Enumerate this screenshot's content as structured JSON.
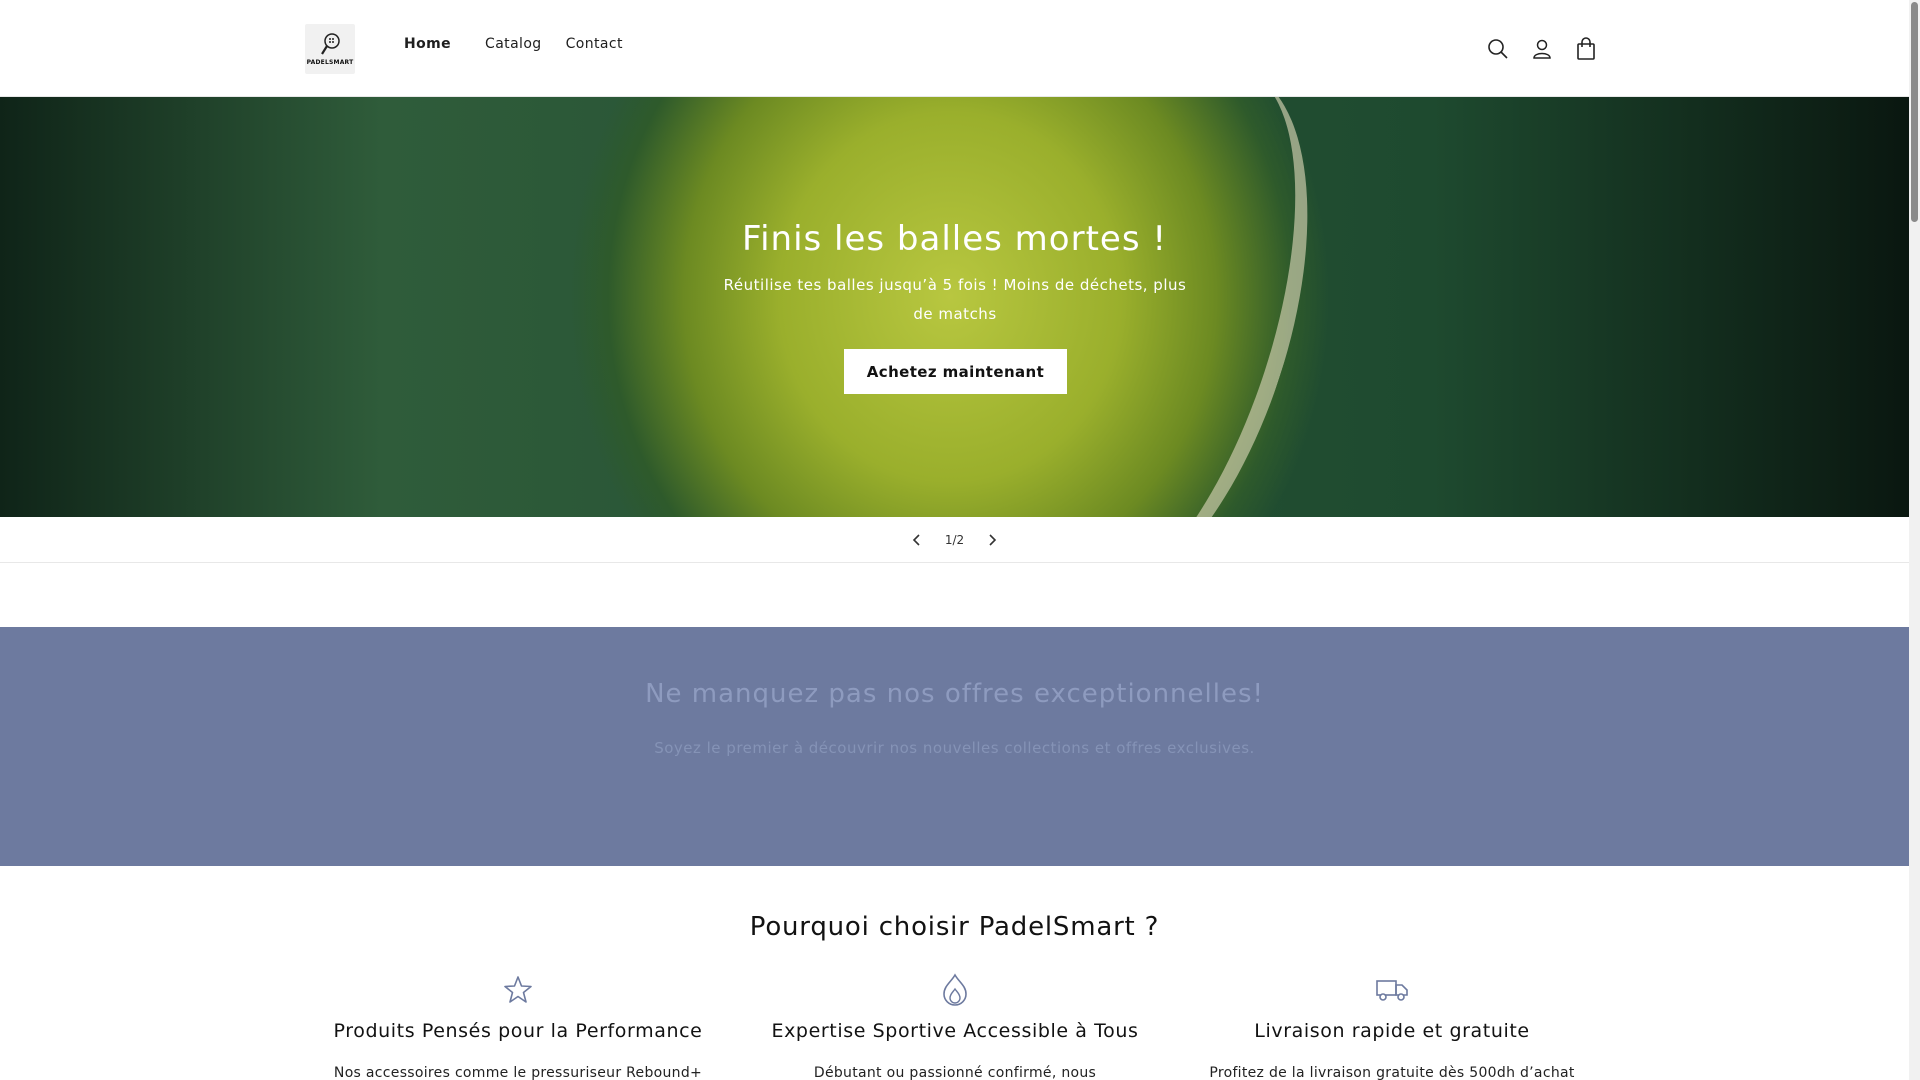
{
  "header": {
    "logo_text": "PADELSMART",
    "nav": [
      {
        "label": "Home",
        "active": true
      },
      {
        "label": "Catalog",
        "active": false
      },
      {
        "label": "Contact",
        "active": false
      }
    ],
    "icons": [
      "search-icon",
      "account-icon",
      "cart-icon"
    ]
  },
  "hero": {
    "title": "Finis les balles mortes !",
    "subtitle": "Réutilise tes balles jusqu’à 5 fois ! Moins de déchets, plus de matchs",
    "button_label": "Achetez maintenant"
  },
  "slider": {
    "counter": "1/2",
    "prev_icon": "chevron-left-icon",
    "next_icon": "chevron-right-icon"
  },
  "newsletter": {
    "title": "Ne manquez pas nos offres exceptionnelles!",
    "subtitle": "Soyez le premier à découvrir nos nouvelles collections et offres exclusives.",
    "background_color": "#6d7a9f"
  },
  "why": {
    "title": "Pourquoi choisir PadelSmart ?",
    "features": [
      {
        "icon": "star-icon",
        "title": "Produits Pensés pour la Performance",
        "text": "Nos accessoires comme le pressuriseur Rebound+"
      },
      {
        "icon": "flame-icon",
        "title": "Expertise Sportive Accessible à Tous",
        "text": "Débutant ou passionné confirmé, nous"
      },
      {
        "icon": "truck-icon",
        "title": "Livraison rapide et gratuite",
        "text": "Profitez de la livraison gratuite dès 500dh d’achat"
      }
    ]
  }
}
